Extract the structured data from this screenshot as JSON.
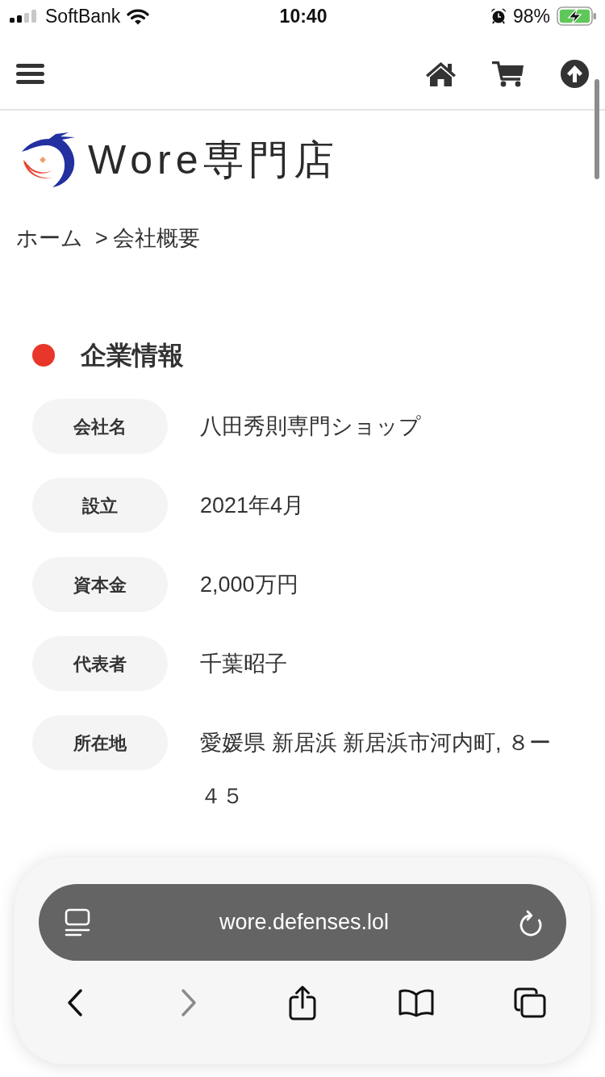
{
  "status_bar": {
    "carrier": "SoftBank",
    "time": "10:40",
    "battery": "98%"
  },
  "logo": {
    "text": "Wore専門店"
  },
  "breadcrumb": [
    {
      "label": "ホーム",
      "kind": "link"
    },
    {
      "label": ">",
      "kind": "separator"
    },
    {
      "label": "会社概要",
      "kind": "current"
    }
  ],
  "section": {
    "title": "企業情報",
    "rows": [
      {
        "label": "会社名",
        "value": "八田秀則専門ショップ"
      },
      {
        "label": "設立",
        "value": "2021年4月"
      },
      {
        "label": "資本金",
        "value": "2,000万円"
      },
      {
        "label": "代表者",
        "value": "千葉昭子"
      },
      {
        "label": "所在地",
        "value": "愛媛県 新居浜 新居浜市河内町, ８ー４５"
      }
    ]
  },
  "browser": {
    "url": "wore.defenses.lol",
    "buttons": [
      {
        "kind": "back",
        "disabled": false
      },
      {
        "kind": "forward",
        "disabled": true
      },
      {
        "kind": "share",
        "disabled": false
      },
      {
        "kind": "bookmarks",
        "disabled": false
      },
      {
        "kind": "tabs",
        "disabled": false
      }
    ]
  }
}
